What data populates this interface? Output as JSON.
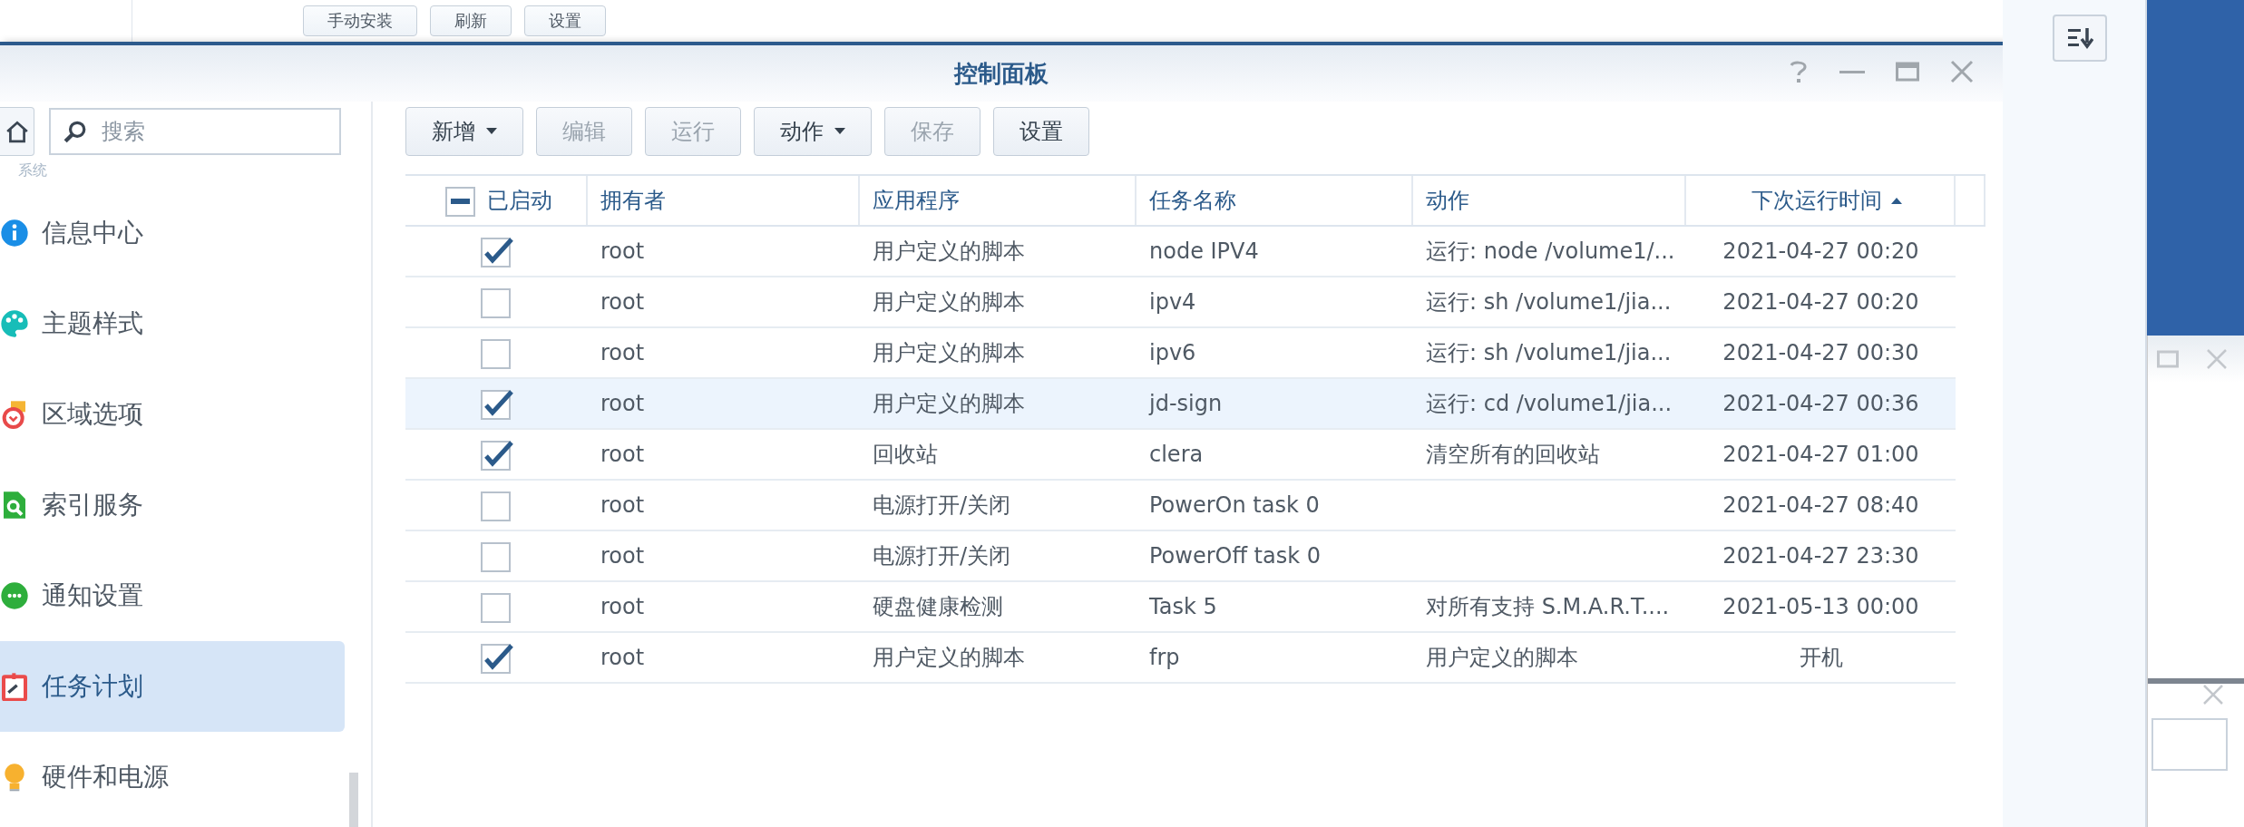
{
  "background_buttons": [
    {
      "label": "手动安装"
    },
    {
      "label": "刷新"
    },
    {
      "label": "设置"
    }
  ],
  "window": {
    "title": "控制面板"
  },
  "sidebar": {
    "search": {
      "placeholder": "搜索"
    },
    "section": "系统",
    "items": [
      {
        "label": "信息中心",
        "kind": "info",
        "selected": false
      },
      {
        "label": "主题样式",
        "kind": "palette",
        "selected": false
      },
      {
        "label": "区域选项",
        "kind": "region",
        "selected": false
      },
      {
        "label": "索引服务",
        "kind": "index",
        "selected": false
      },
      {
        "label": "通知设置",
        "kind": "notify",
        "selected": false
      },
      {
        "label": "任务计划",
        "kind": "calendar",
        "selected": true
      },
      {
        "label": "硬件和电源",
        "kind": "bulb",
        "selected": false
      }
    ]
  },
  "toolbar": [
    {
      "label": "新增",
      "disabled": false,
      "dropdown": true
    },
    {
      "label": "编辑",
      "disabled": true,
      "dropdown": false
    },
    {
      "label": "运行",
      "disabled": true,
      "dropdown": false
    },
    {
      "label": "动作",
      "disabled": false,
      "dropdown": true
    },
    {
      "label": "保存",
      "disabled": true,
      "dropdown": false
    },
    {
      "label": "设置",
      "disabled": false,
      "dropdown": false
    }
  ],
  "table": {
    "header_checkbox": {
      "indeterminate": true
    },
    "columns": [
      {
        "label": "已启动",
        "sorted": false
      },
      {
        "label": "拥有者",
        "sorted": false
      },
      {
        "label": "应用程序",
        "sorted": false
      },
      {
        "label": "任务名称",
        "sorted": false
      },
      {
        "label": "动作",
        "sorted": false
      },
      {
        "label": "下次运行时间",
        "sorted": true
      }
    ],
    "rows": [
      {
        "enabled": true,
        "owner": "root",
        "application": "用户定义的脚本",
        "task": "node IPV4",
        "action": "运行: node /volume1/...",
        "next_run": "2021-04-27 00:20",
        "selected": false
      },
      {
        "enabled": false,
        "owner": "root",
        "application": "用户定义的脚本",
        "task": "ipv4",
        "action": "运行: sh /volume1/jia...",
        "next_run": "2021-04-27 00:20",
        "selected": false
      },
      {
        "enabled": false,
        "owner": "root",
        "application": "用户定义的脚本",
        "task": "ipv6",
        "action": "运行: sh /volume1/jia...",
        "next_run": "2021-04-27 00:30",
        "selected": false
      },
      {
        "enabled": true,
        "owner": "root",
        "application": "用户定义的脚本",
        "task": "jd-sign",
        "action": "运行: cd /volume1/jia...",
        "next_run": "2021-04-27 00:36",
        "selected": true
      },
      {
        "enabled": true,
        "owner": "root",
        "application": "回收站",
        "task": "clera",
        "action": "清空所有的回收站",
        "next_run": "2021-04-27 01:00",
        "selected": false
      },
      {
        "enabled": false,
        "owner": "root",
        "application": "电源打开/关闭",
        "task": "PowerOn task 0",
        "next_run": "2021-04-27 08:40",
        "selected": false
      },
      {
        "enabled": false,
        "owner": "root",
        "application": "电源打开/关闭",
        "task": "PowerOff task 0",
        "next_run": "2021-04-27 23:30",
        "selected": false
      },
      {
        "enabled": false,
        "owner": "root",
        "application": "硬盘健康检测",
        "task": "Task 5",
        "action": "对所有支持 S.M.A.R.T....",
        "next_run": "2021-05-13 00:00",
        "selected": false
      },
      {
        "enabled": true,
        "owner": "root",
        "application": "用户定义的脚本",
        "task": "frp",
        "action": "用户定义的脚本",
        "next_run": "开机",
        "selected": false
      }
    ]
  }
}
